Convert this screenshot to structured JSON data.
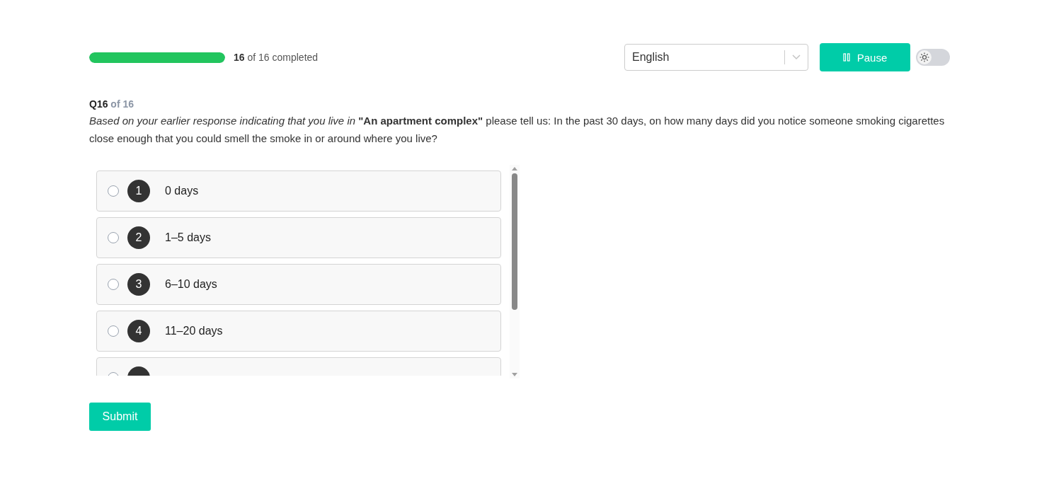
{
  "progress": {
    "level": 1,
    "count": "16",
    "total_text": "of 16 completed"
  },
  "language_select": {
    "value": "English"
  },
  "pause_button": {
    "label": "Pause"
  },
  "theme_toggle": {
    "on": false
  },
  "question": {
    "number": "Q16",
    "of": "of 16",
    "text": "*Based on your earlier response indicating that you live in* **\"An apartment complex\"**  please tell us: In the past 30 days, on how many days did you notice someone smoking cigarettes close enough that you could smell the smoke in or around where you live?"
  },
  "options": [
    {
      "number": "1",
      "label": "0 days",
      "selected": false
    },
    {
      "number": "2",
      "label": "1–5 days",
      "selected": false
    },
    {
      "number": "3",
      "label": "6–10 days",
      "selected": false
    },
    {
      "number": "4",
      "label": "11–20 days",
      "selected": false
    },
    {
      "selected": false
    }
  ],
  "submit_button": {
    "label": "Submit"
  }
}
